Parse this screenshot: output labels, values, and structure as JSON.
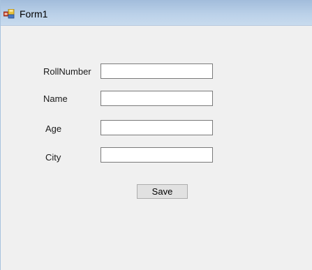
{
  "window": {
    "title": "Form1"
  },
  "form": {
    "fields": [
      {
        "label": "RollNumber",
        "value": ""
      },
      {
        "label": "Name",
        "value": ""
      },
      {
        "label": "Age",
        "value": ""
      },
      {
        "label": "City",
        "value": ""
      }
    ],
    "save_label": "Save"
  }
}
